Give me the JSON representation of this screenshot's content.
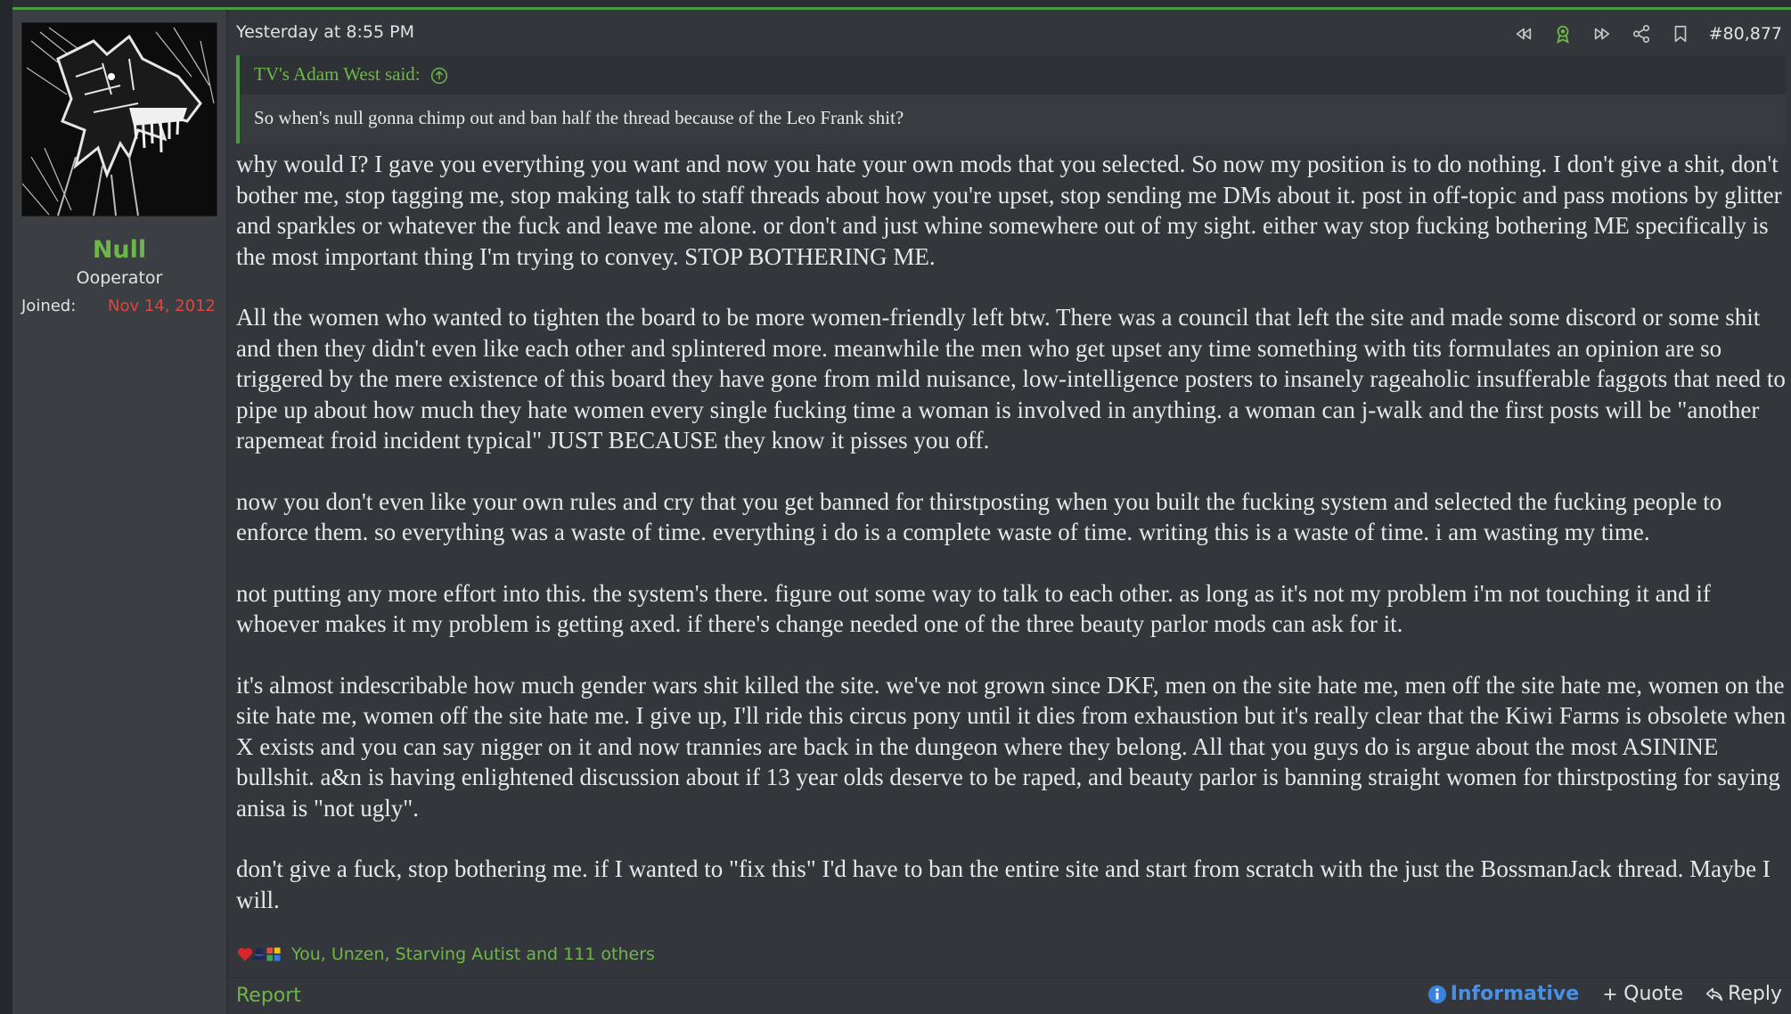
{
  "colors": {
    "accent": "#6fb64a",
    "joined": "#e0453c",
    "informative": "#4a8fe0"
  },
  "user": {
    "name": "Null",
    "title": "Ooperator",
    "joined_label": "Joined:",
    "joined_date": "Nov 14, 2012"
  },
  "post": {
    "date": "Yesterday at 8:55 PM",
    "number": "#80,877",
    "header_icons": [
      "rewind-icon",
      "award-icon",
      "fast-forward-icon",
      "share-icon",
      "bookmark-icon"
    ]
  },
  "quote": {
    "author": "TV's Adam West said:",
    "text": "So when's null gonna chimp out and ban half the thread because of the Leo Frank shit?"
  },
  "body": {
    "p1": "why would I? I gave you everything you want and now you hate your own mods that you selected. So now my position is to do nothing. I don't give a shit, don't bother me, stop tagging me, stop making talk to staff threads about how you're upset, stop sending me DMs about it. post in off-topic and pass motions by glitter and sparkles or whatever the fuck and leave me alone. or don't and just whine somewhere out of my sight. either way stop fucking bothering ME specifically is the most important thing I'm trying to convey. STOP BOTHERING ME.",
    "p2": "All the women who wanted to tighten the board to be more women-friendly left btw. There was a council that left the site and made some discord or some shit and then they didn't even like each other and splintered more. meanwhile the men who get upset any time something with tits formulates an opinion are so triggered by the mere existence of this board they have gone from mild nuisance, low-intelligence posters to insanely rageaholic insufferable faggots that need to pipe up about how much they hate women every single fucking time a woman is involved in anything. a woman can j-walk and the first posts will be \"another rapemeat froid incident typical\" JUST BECAUSE they know it pisses you off.",
    "p3": "now you don't even like your own rules and cry that you get banned for thirstposting when you built the fucking system and selected the fucking people to enforce them. so everything was a waste of time. everything i do is a complete waste of time. writing this is a waste of time. i am wasting my time.",
    "p4": "not putting any more effort into this. the system's there. figure out some way to talk to each other. as long as it's not my problem i'm not touching it and if whoever makes it my problem is getting axed. if there's change needed one of the three beauty parlor mods can ask for it.",
    "p5": "it's almost indescribable how much gender wars shit killed the site. we've not grown since DKF, men on the site hate me, men off the site hate me, women on the site hate me, women off the site hate me. I give up, I'll ride this circus pony until it dies from exhaustion but it's really clear that the Kiwi Farms is obsolete when X exists and you can say nigger on it and now trannies are back in the dungeon where they belong. All that you guys do is argue about the most ASININE bullshit. a&n is having enlightened discussion about if 13 year olds deserve to be raped, and beauty parlor is banning straight women for thirstposting for saying anisa is \"not ugly\".",
    "p6": "don't give a fuck, stop bothering me. if I wanted to \"fix this\" I'd have to ban the entire site and start from scratch with the just the BossmanJack thread. Maybe I will."
  },
  "reactions": {
    "icons": [
      "heart-icon",
      "hat-icon",
      "puzzle-icon"
    ],
    "text": "You, Unzen, Starving Autist and 111 others"
  },
  "footer": {
    "report": "Report",
    "informative": "Informative",
    "quote": "Quote",
    "reply": "Reply"
  }
}
